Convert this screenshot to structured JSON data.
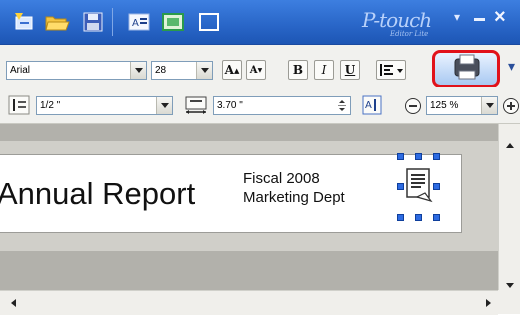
{
  "titlebar": {
    "brand_name": "P-touch",
    "brand_sub": "Editor Lite",
    "buttons": [
      "new-label-icon",
      "open-folder-icon",
      "save-icon",
      "text-icon",
      "image-icon",
      "frame-icon"
    ]
  },
  "toolbar1": {
    "font_family": "Arial",
    "font_size": "28",
    "grow_font_label": "A",
    "shrink_font_label": "A",
    "bold_label": "B",
    "italic_label": "I",
    "underline_label": "U"
  },
  "toolbar2": {
    "tape_width": "1/2 \"",
    "label_length": "3.70 \"",
    "zoom": "125 %"
  },
  "label": {
    "title": "Annual Report",
    "line1": "Fiscal 2008",
    "line2": "Marketing Dept"
  },
  "colors": {
    "titlebar": "#2a67c9",
    "print_highlight": "#e1121b",
    "selection_handle": "#2d6be2"
  }
}
